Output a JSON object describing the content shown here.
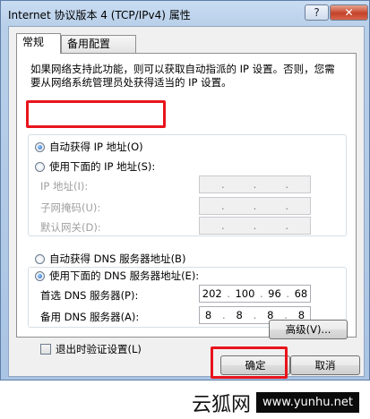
{
  "window": {
    "title": "Internet 协议版本 4 (TCP/IPv4) 属性",
    "help_label": "?",
    "close_label": "✕"
  },
  "tabs": [
    {
      "label": "常规"
    },
    {
      "label": "备用配置"
    }
  ],
  "description": "如果网络支持此功能，则可以获取自动指派的 IP 设置。否则，您需要从网络系统管理员处获得适当的 IP 设置。",
  "ip": {
    "auto_label": "自动获得 IP 地址(O)",
    "manual_label": "使用下面的 IP 地址(S):",
    "address_label": "IP 地址(I):",
    "mask_label": "子网掩码(U):",
    "gateway_label": "默认网关(D):",
    "auto_selected": true
  },
  "dns": {
    "auto_label": "自动获得 DNS 服务器地址(B)",
    "manual_label": "使用下面的 DNS 服务器地址(E):",
    "preferred_label": "首选 DNS 服务器(P):",
    "alternate_label": "备用 DNS 服务器(A):",
    "preferred_octets": [
      "202",
      "100",
      "96",
      "68"
    ],
    "alternate_octets": [
      "8",
      "8",
      "8",
      "8"
    ],
    "manual_selected": true
  },
  "validate_label": "退出时验证设置(L)",
  "advanced_label": "高级(V)...",
  "ok_label": "确定",
  "cancel_label": "取消",
  "watermark": {
    "brand": "云狐网",
    "url": "www.yunhu.net"
  },
  "colors": {
    "highlight": "#e8141c"
  }
}
